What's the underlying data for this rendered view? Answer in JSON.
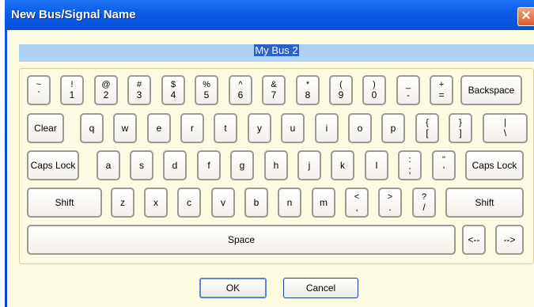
{
  "window": {
    "title": "New Bus/Signal Name",
    "close_glyph": "✕"
  },
  "name_field": {
    "value": "My Bus 2"
  },
  "keyboard": {
    "row1": [
      {
        "top": "~",
        "bottom": "`"
      },
      {
        "top": "!",
        "bottom": "1"
      },
      {
        "top": "@",
        "bottom": "2"
      },
      {
        "top": "#",
        "bottom": "3"
      },
      {
        "top": "$",
        "bottom": "4"
      },
      {
        "top": "%",
        "bottom": "5"
      },
      {
        "top": "^",
        "bottom": "6"
      },
      {
        "top": "&",
        "bottom": "7"
      },
      {
        "top": "*",
        "bottom": "8"
      },
      {
        "top": "(",
        "bottom": "9"
      },
      {
        "top": ")",
        "bottom": "0"
      },
      {
        "top": "_",
        "bottom": "-"
      },
      {
        "top": "+",
        "bottom": "="
      },
      {
        "label": "Backspace"
      }
    ],
    "row2": [
      {
        "label": "Clear"
      },
      {
        "label": "q"
      },
      {
        "label": "w"
      },
      {
        "label": "e"
      },
      {
        "label": "r"
      },
      {
        "label": "t"
      },
      {
        "label": "y"
      },
      {
        "label": "u"
      },
      {
        "label": "i"
      },
      {
        "label": "o"
      },
      {
        "label": "p"
      },
      {
        "top": "{",
        "bottom": "["
      },
      {
        "top": "}",
        "bottom": "]"
      },
      {
        "top": "|",
        "bottom": "\\"
      }
    ],
    "row3": [
      {
        "label": "Caps Lock"
      },
      {
        "label": "a"
      },
      {
        "label": "s"
      },
      {
        "label": "d"
      },
      {
        "label": "f"
      },
      {
        "label": "g"
      },
      {
        "label": "h"
      },
      {
        "label": "j"
      },
      {
        "label": "k"
      },
      {
        "label": "l"
      },
      {
        "top": ":",
        "bottom": ";"
      },
      {
        "top": "\"",
        "bottom": "'"
      },
      {
        "label": "Caps Lock"
      }
    ],
    "row4": [
      {
        "label": "Shift"
      },
      {
        "label": "z"
      },
      {
        "label": "x"
      },
      {
        "label": "c"
      },
      {
        "label": "v"
      },
      {
        "label": "b"
      },
      {
        "label": "n"
      },
      {
        "label": "m"
      },
      {
        "top": "<",
        "bottom": ","
      },
      {
        "top": ">",
        "bottom": "."
      },
      {
        "top": "?",
        "bottom": "/"
      },
      {
        "label": "Shift"
      }
    ],
    "row5": [
      {
        "label": "Space"
      },
      {
        "label": "<--"
      },
      {
        "label": "-->"
      }
    ]
  },
  "buttons": {
    "ok": "OK",
    "cancel": "Cancel"
  },
  "colors": {
    "titlebar": "#0b5be6",
    "client_bg": "#fdfbe0",
    "field_bg": "#aed1f7",
    "selection": "#2a62c9"
  }
}
